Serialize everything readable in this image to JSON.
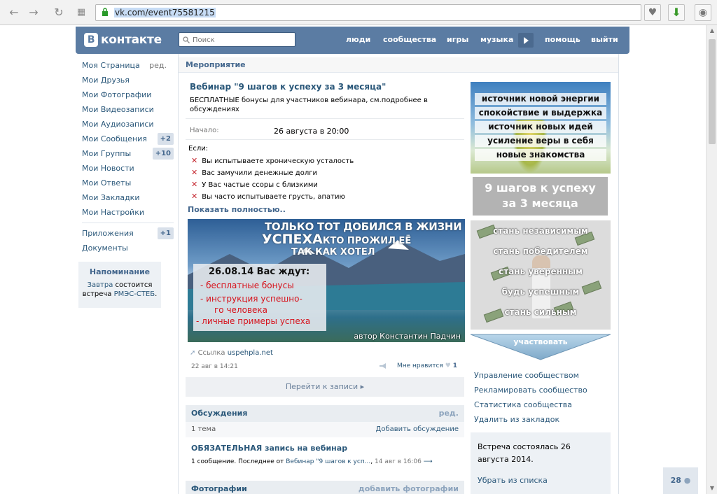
{
  "browser": {
    "url": "vk.com/event75581215"
  },
  "header": {
    "logo_text": "контакте",
    "logo_letter": "В",
    "search_placeholder": "Поиск",
    "nav": [
      "люди",
      "сообщества",
      "игры",
      "музыка",
      "помощь",
      "выйти"
    ]
  },
  "menu": {
    "items": [
      {
        "label": "Моя Страница",
        "extra": "ред."
      },
      {
        "label": "Мои Друзья"
      },
      {
        "label": "Мои Фотографии"
      },
      {
        "label": "Мои Видеозаписи"
      },
      {
        "label": "Мои Аудиозаписи"
      },
      {
        "label": "Мои Сообщения",
        "badge": "+2"
      },
      {
        "label": "Мои Группы",
        "badge": "+10"
      },
      {
        "label": "Мои Новости"
      },
      {
        "label": "Мои Ответы"
      },
      {
        "label": "Мои Закладки"
      },
      {
        "label": "Мои Настройки"
      }
    ],
    "apps": {
      "label": "Приложения",
      "badge": "+1"
    },
    "docs": {
      "label": "Документы"
    }
  },
  "reminder": {
    "title": "Напоминание",
    "when": "Завтра",
    "text_mid": " состоится встреча ",
    "event": "РМЭС-СТЕБ",
    "end": "."
  },
  "event": {
    "section": "Мероприятие",
    "title": "Вебинар \"9 шагов к успеху за 3 месяца\"",
    "description": "БЕСПЛАТНЫЕ бонусы для участников вебинара, см.подробнее в обсуждениях",
    "start_label": "Начало:",
    "start_value": "26 августа в 20:00",
    "if_label": "Если:",
    "conditions": [
      "Вы испытываете хроническую усталость",
      "Вас замучили денежные долги",
      "У Вас частые ссоры с близкими",
      "Вы часто испытываете грусть, апатию"
    ],
    "show_more": "Показать полностью.."
  },
  "banner": {
    "line1": "ТОЛЬКО ТОТ ДОБИЛСЯ В ЖИЗНИ",
    "line2a": "УСПЕХА",
    "line2b": "КТО ПРОЖИЛ ЕЁ",
    "line3": "ТАК КАК ХОТЕЛ",
    "date": "26.08.14 Вас ждут:",
    "items": [
      "- бесплатные бонусы",
      "- инструкция успешно-",
      "го человека",
      "- личные примеры успеха"
    ],
    "author": "автор Константин Падчин"
  },
  "post": {
    "link_label": "Ссылка",
    "link_url": "uspehpla.net",
    "date": "22 авг в 14:21",
    "like_label": "Мне нравится",
    "like_count": "1",
    "go_to_post": "Перейти к записи"
  },
  "discussions": {
    "title": "Обсуждения",
    "edit": "ред.",
    "count": "1 тема",
    "add": "Добавить обсуждение",
    "topic_title": "ОБЯЗАТЕЛЬНАЯ запись на вебинар",
    "topic_meta_a": "1 сообщение. Последнее от ",
    "topic_meta_link": "Вебинар \"9 шагов к усп...",
    "topic_meta_date": "14 авг в 16:06"
  },
  "photos": {
    "title": "Фотографии",
    "add": "добавить фотографии"
  },
  "right": {
    "ad1": [
      "источник новой энергии",
      "спокойствие и выдержка",
      "источник новых идей",
      "усиление веры в себя",
      "новые знакомства"
    ],
    "ad2": [
      "9 шагов к успеху",
      "за 3 месяца"
    ],
    "ad3": [
      "стань независимым",
      "стань победителем",
      "стань уверенным",
      "будь успешным",
      "стань сильным"
    ],
    "participate": "участвовать",
    "links": [
      "Управление сообществом",
      "Рекламировать сообщество",
      "Статистика сообщества",
      "Удалить из закладок"
    ],
    "status": "Встреча состоялась 26 августа 2014.",
    "unsubscribe": "Убрать из списка"
  },
  "chat_count": "28",
  "colors": {
    "brand": "#5b7ca3",
    "link": "#2b587a",
    "accent_red": "#d6121b"
  }
}
